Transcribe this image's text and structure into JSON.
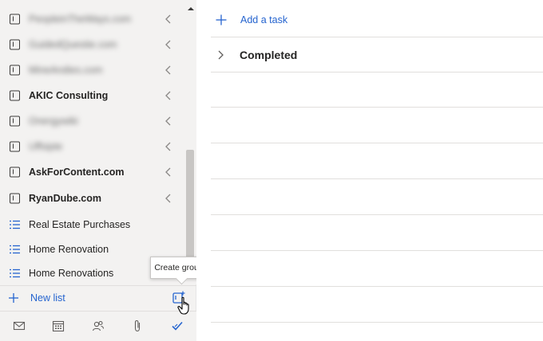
{
  "sidebar": {
    "lists": [
      {
        "label": "PeopleinTheWays.com",
        "kind": "group",
        "blurred": true
      },
      {
        "label": "GuidedQuestie.com",
        "kind": "group",
        "blurred": true
      },
      {
        "label": "MineAndies.com",
        "kind": "group",
        "blurred": true
      },
      {
        "label": "AKIC Consulting",
        "kind": "group",
        "blurred": false
      },
      {
        "label": "Onergywiki",
        "kind": "group",
        "blurred": true
      },
      {
        "label": "Uffsipte",
        "kind": "group",
        "blurred": true
      },
      {
        "label": "AskForContent.com",
        "kind": "group",
        "blurred": false
      },
      {
        "label": "RyanDube.com",
        "kind": "group",
        "blurred": false
      },
      {
        "label": "Real Estate Purchases",
        "kind": "list",
        "blurred": false
      },
      {
        "label": "Home Renovation",
        "kind": "list",
        "blurred": false
      },
      {
        "label": "Home Renovations",
        "kind": "list",
        "blurred": false
      }
    ],
    "new_list_label": "New list",
    "tooltip": "Create group",
    "apps": [
      "mail-icon",
      "calendar-icon",
      "people-icon",
      "attachment-icon",
      "todo-check-icon"
    ]
  },
  "main": {
    "add_task_label": "Add a task",
    "completed_label": "Completed"
  },
  "colors": {
    "accent": "#2564cf",
    "sidebar_bg": "#f3f2f1",
    "divider": "#e1dfdd"
  }
}
